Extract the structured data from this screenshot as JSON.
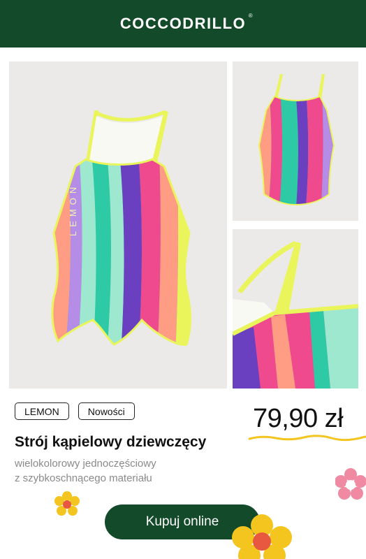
{
  "header": {
    "brand": "COCCODRILLO",
    "registered": "®"
  },
  "gallery": {
    "main_print": "LEMON",
    "colors": {
      "yellow": "#e9f55a",
      "pink": "#f04a8e",
      "teal": "#2ec9a5",
      "purple": "#6a3fc0",
      "lilac": "#b58ce6",
      "peach": "#ffa07a",
      "mint": "#9fe8d0"
    }
  },
  "tags": [
    "LEMON",
    "Nowości"
  ],
  "product": {
    "price": "79,90 zł",
    "title": "Strój kąpielowy dziewczęcy",
    "desc_line1": "wielokolorowy jednoczęściowy",
    "desc_line2": "z szybkoschnącego materiału"
  },
  "cta": {
    "label": "Kupuj online"
  },
  "theme": {
    "primary": "#124a2a",
    "accent_yellow": "#f4c51e"
  }
}
